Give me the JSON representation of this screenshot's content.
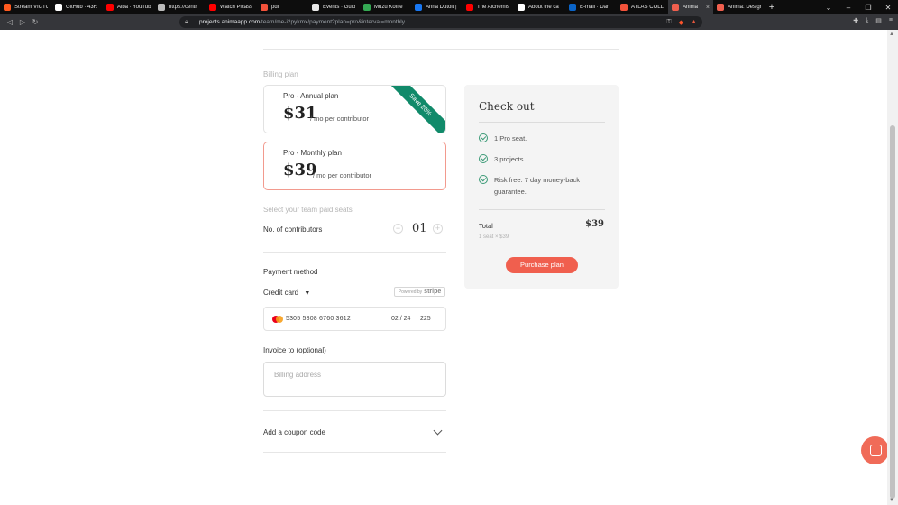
{
  "browser": {
    "tabs": [
      {
        "title": "Stream VICTO",
        "color": "#ff5a1f"
      },
      {
        "title": "GitHub · 43R",
        "color": "#ffffff"
      },
      {
        "title": "Alba · YouTub",
        "color": "#ff0000"
      },
      {
        "title": "https://centr",
        "color": "#bbbbbb"
      },
      {
        "title": "Watch Picass",
        "color": "#ff0000"
      },
      {
        "title": "pdf",
        "color": "#f2523a"
      },
      {
        "title": "Events · Gulb",
        "color": "#e8e8e8"
      },
      {
        "title": "Muzu Koffie",
        "color": "#34a853"
      },
      {
        "title": "Anna Dutoit |",
        "color": "#1877f2"
      },
      {
        "title": "The Alchemis",
        "color": "#ff0000"
      },
      {
        "title": "About the ca",
        "color": "#ffffff"
      },
      {
        "title": "E-mail · Dan",
        "color": "#0a64c8"
      },
      {
        "title": "ATLAS COLLE",
        "color": "#f2523a"
      },
      {
        "title": "Anima",
        "color": "#f05f4e",
        "active": true
      },
      {
        "title": "Anima: Design",
        "color": "#f05f4e"
      }
    ],
    "url_host": "projects.animaapp.com",
    "url_path": "/team/me-i2pykmx/payment?plan=pro&interval=monthly"
  },
  "billing": {
    "section_label": "Billing plan",
    "annual": {
      "name": "Pro - Annual plan",
      "price": "$31",
      "per": "/ mo per contributor",
      "ribbon": "Save 20%"
    },
    "monthly": {
      "name": "Pro - Monthly plan",
      "price": "$39",
      "per": "/ mo per contributor"
    }
  },
  "seats": {
    "section_label": "Select your team paid seats",
    "label": "No. of contributors",
    "count": "01",
    "minus": "−",
    "plus": "+"
  },
  "payment": {
    "label": "Payment method",
    "method": "Credit card",
    "stripe_prefix": "Powered by",
    "stripe_name": "stripe",
    "card_number": "5305 5808 6760 3612",
    "expiry": "02 / 24",
    "cvc": "225"
  },
  "invoice": {
    "label": "Invoice to (optional)",
    "placeholder": "Billing address"
  },
  "coupon": {
    "label": "Add a coupon code"
  },
  "checkout": {
    "title": "Check out",
    "features": [
      "1 Pro seat.",
      "3 projects.",
      "Risk free. 7 day money-back guarantee."
    ],
    "total_label": "Total",
    "total_value": "$39",
    "total_sub": "1 seat × $39",
    "button": "Purchase plan"
  }
}
